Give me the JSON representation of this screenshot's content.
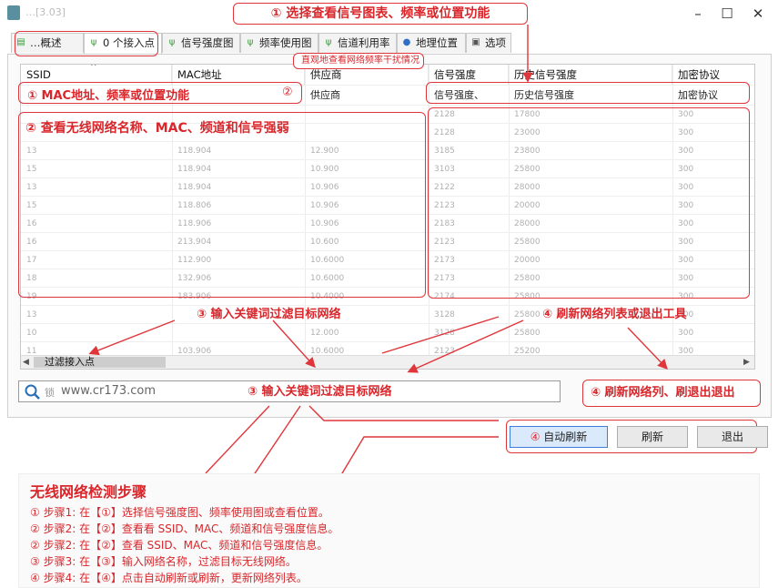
{
  "window": {
    "title": "…[3.03]",
    "controls": [
      "–",
      "☐",
      "✕"
    ]
  },
  "tabs": [
    {
      "label": "…概述",
      "icon": "overview-icon"
    },
    {
      "label": "0 个接入点",
      "icon": "antenna-icon"
    },
    {
      "label": "信号强度图",
      "icon": "signal-icon"
    },
    {
      "label": "频率使用图",
      "icon": "signal-icon"
    },
    {
      "label": "信道利用率",
      "icon": "signal-icon"
    },
    {
      "label": "地理位置",
      "icon": "location-pin-icon"
    },
    {
      "label": "选项",
      "icon": "options-icon"
    }
  ],
  "annotations": {
    "top_callout": "① 选择查看信号图表、频率或位置功能",
    "small_callout": "直观地查看网络频率干扰情况",
    "header_note": "①    MAC地址、频率或位置功能",
    "header_marker": "②",
    "area_title": "② 查看无线网络名称、MAC、频道和信号强弱",
    "filter_note_1": "③ 输入关键词过滤目标网络",
    "refresh_note_1": "④ 刷新网络列表或退出工具",
    "filter_note_2": "③ 输入关键词过滤目标网络",
    "refresh_note_2": "④ 刷新网络列、刷退出退出"
  },
  "table": {
    "columns": [
      "SSID",
      "MAC地址",
      "供应商",
      "信号强度",
      "历史信号强度",
      "加密协议"
    ],
    "first_row": [
      "",
      "",
      "供应商",
      "信号强度、",
      "历史信号强度",
      "加密协议"
    ],
    "rows": [
      [
        "",
        "",
        "",
        "2128",
        "17800",
        "300"
      ],
      [
        "",
        "",
        "",
        "2128",
        "23000",
        "300"
      ],
      [
        "13",
        "118.904",
        "12.900",
        "3185",
        "23800",
        "300"
      ],
      [
        "15",
        "118.904",
        "10.900",
        "3103",
        "25800",
        "300"
      ],
      [
        "13",
        "118.904",
        "10.906",
        "2122",
        "28000",
        "300"
      ],
      [
        "15",
        "118.806",
        "10.906",
        "2123",
        "20000",
        "300"
      ],
      [
        "16",
        "118.906",
        "10.906",
        "2183",
        "28000",
        "300"
      ],
      [
        "16",
        "213.904",
        "10.600",
        "2123",
        "25800",
        "300"
      ],
      [
        "17",
        "112.900",
        "10.6000",
        "2173",
        "20000",
        "300"
      ],
      [
        "18",
        "132.906",
        "10.6000",
        "2173",
        "25800",
        "300"
      ],
      [
        "19",
        "183.906",
        "10.4000",
        "2174",
        "25800",
        "300"
      ],
      [
        "13",
        "",
        "",
        "3128",
        "25800",
        "300"
      ],
      [
        "10",
        "",
        "12.000",
        "3128",
        "25800",
        "300"
      ],
      [
        "11",
        "103.906",
        "10.6000",
        "2123",
        "25200",
        "300"
      ]
    ]
  },
  "filter": {
    "label": "过滤接入点",
    "placeholder": "www.cr173.com",
    "prefix": "锁"
  },
  "buttons": {
    "auto_refresh": "自动刷新",
    "auto_marker": "④",
    "refresh": "刷新",
    "exit": "退出"
  },
  "steps": {
    "title": "无线网络检测步骤",
    "items": [
      "① 步骤1: 在【①】选择信号强度图、频率使用图或查看位置。",
      "② 步骤2: 在【②】查看看 SSID、MAC、频道和信号强度信息。",
      "② 步骤2: 在【②】查看 SSID、MAC、频道和信号强度信息。",
      "③ 步骤3: 在【③】输入网络名称，过滤目标无线网络。",
      "④ 步骤4: 在【④】点击自动刷新或刷新，更新网络列表。"
    ]
  },
  "colors": {
    "annotation_red": "#e0353a",
    "accent_blue": "#3c7fd9",
    "button_highlight": "#dbeafb"
  }
}
